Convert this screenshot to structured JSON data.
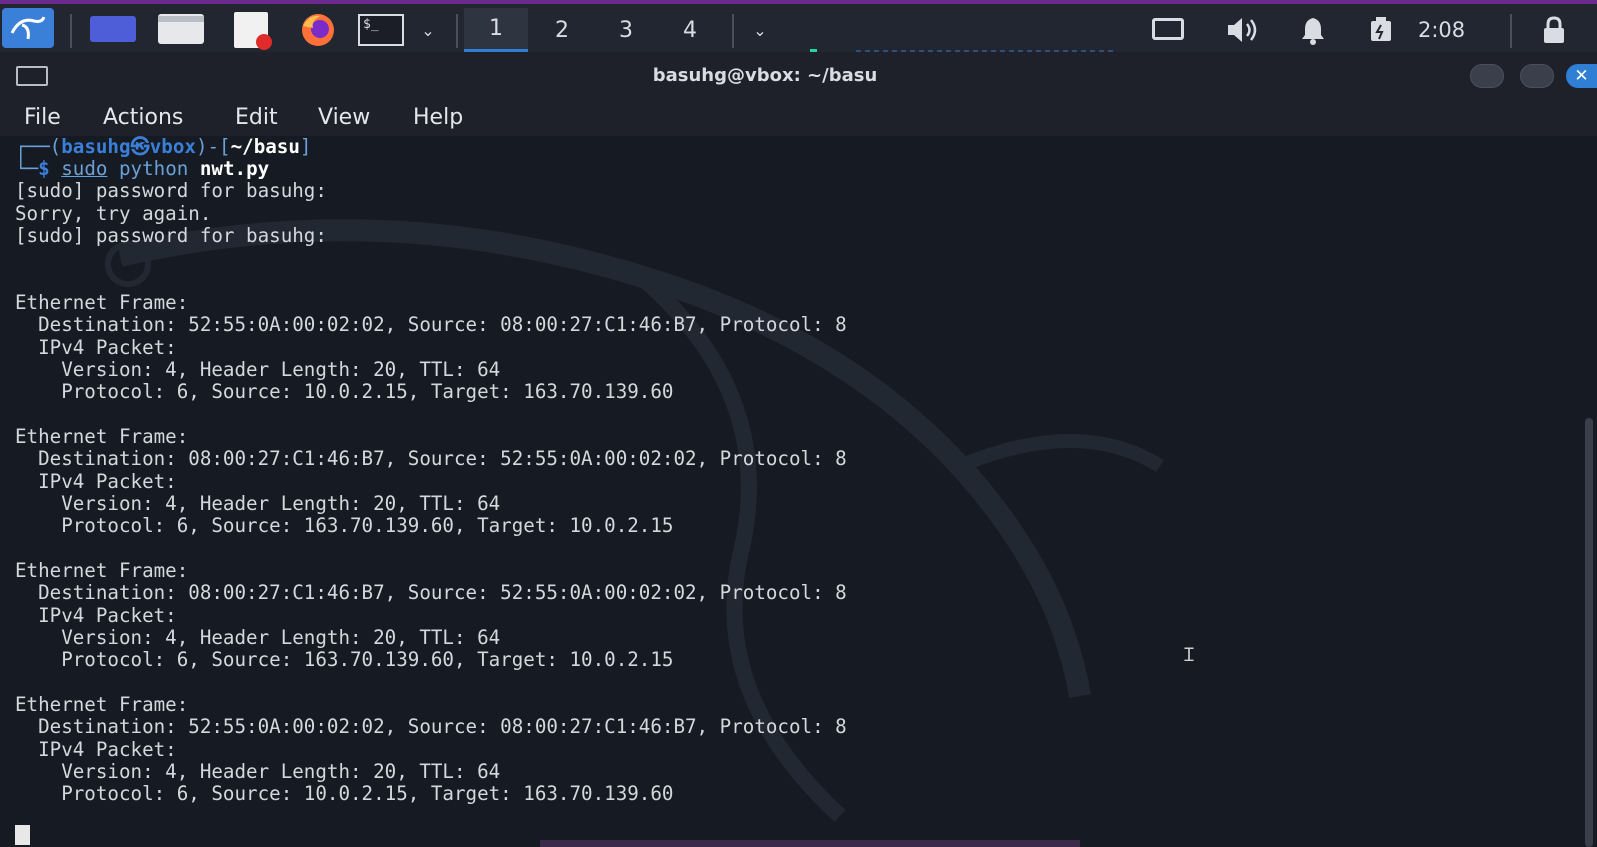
{
  "panel": {
    "workspaces": [
      "1",
      "2",
      "3",
      "4"
    ],
    "active_workspace": "1",
    "clock": "2:08",
    "icons": [
      "kali-menu-icon",
      "desktop-icon",
      "file-manager-icon",
      "text-editor-icon",
      "firefox-icon",
      "terminal-icon",
      "dropdown-icon",
      "overflow-dropdown-icon",
      "display-icon",
      "volume-icon",
      "notifications-icon",
      "battery-icon",
      "lock-icon"
    ]
  },
  "window": {
    "title": "basuhg@vbox: ~/basu",
    "close_symbol": "✕"
  },
  "menu": [
    "File",
    "Actions",
    "Edit",
    "View",
    "Help"
  ],
  "terminal": {
    "prompt_open": "┌──(",
    "prompt_user": "basuhg㉿vbox",
    "prompt_mid": ")-[",
    "prompt_path": "~/basu",
    "prompt_close": "]",
    "prompt_cont": "└─",
    "prompt_dollar": "$ ",
    "cmd_sudo": "sudo",
    "cmd_python": " python ",
    "cmd_file": "nwt.py",
    "lines": [
      "[sudo] password for basuhg:",
      "Sorry, try again.",
      "[sudo] password for basuhg:",
      "",
      "",
      "Ethernet Frame:",
      "  Destination: 52:55:0A:00:02:02, Source: 08:00:27:C1:46:B7, Protocol: 8",
      "  IPv4 Packet:",
      "    Version: 4, Header Length: 20, TTL: 64",
      "    Protocol: 6, Source: 10.0.2.15, Target: 163.70.139.60",
      "",
      "Ethernet Frame:",
      "  Destination: 08:00:27:C1:46:B7, Source: 52:55:0A:00:02:02, Protocol: 8",
      "  IPv4 Packet:",
      "    Version: 4, Header Length: 20, TTL: 64",
      "    Protocol: 6, Source: 163.70.139.60, Target: 10.0.2.15",
      "",
      "Ethernet Frame:",
      "  Destination: 08:00:27:C1:46:B7, Source: 52:55:0A:00:02:02, Protocol: 8",
      "  IPv4 Packet:",
      "    Version: 4, Header Length: 20, TTL: 64",
      "    Protocol: 6, Source: 163.70.139.60, Target: 10.0.2.15",
      "",
      "Ethernet Frame:",
      "  Destination: 52:55:0A:00:02:02, Source: 08:00:27:C1:46:B7, Protocol: 8",
      "  IPv4 Packet:",
      "    Version: 4, Header Length: 20, TTL: 64",
      "    Protocol: 6, Source: 10.0.2.15, Target: 163.70.139.60"
    ]
  },
  "colors": {
    "accent": "#2f7fd4",
    "panel_border": "#6b2a8c",
    "prompt_blue": "#3a7fd8"
  }
}
